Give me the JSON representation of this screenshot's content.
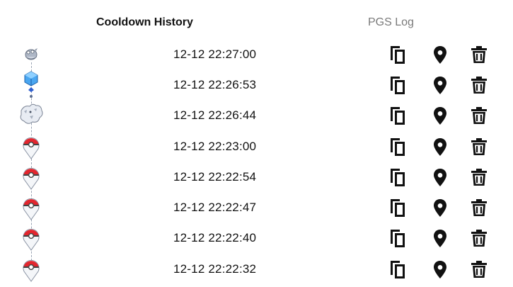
{
  "tabs": {
    "cooldown_history": "Cooldown History",
    "pgs_log": "PGS Log"
  },
  "colors": {
    "active_tab": "#111111",
    "inactive_tab": "#7a7a7a",
    "pokeball_red": "#e3262e",
    "gem_blue": "#2f8de0"
  },
  "entries": [
    {
      "icon": "pokemon-gray-icon",
      "time": "12-12 22:27:00"
    },
    {
      "icon": "blue-cube-icon",
      "time": "12-12 22:26:53"
    },
    {
      "icon": "pokemon-white-dragon-icon",
      "time": "12-12 22:26:44"
    },
    {
      "icon": "pokeball-pin-icon",
      "time": "12-12 22:23:00"
    },
    {
      "icon": "pokeball-pin-icon",
      "time": "12-12 22:22:54"
    },
    {
      "icon": "pokeball-pin-icon",
      "time": "12-12 22:22:47"
    },
    {
      "icon": "pokeball-pin-icon",
      "time": "12-12 22:22:40"
    },
    {
      "icon": "pokeball-pin-icon",
      "time": "12-12 22:22:32"
    }
  ],
  "actions": {
    "copy": "copy-icon",
    "locate": "map-pin-icon",
    "delete": "trash-icon"
  }
}
